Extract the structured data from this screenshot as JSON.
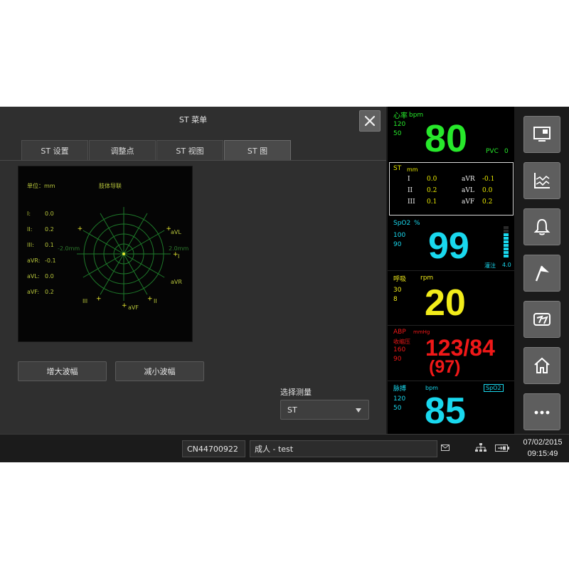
{
  "dialog": {
    "title": "ST 菜单",
    "tabs": [
      {
        "label": "ST 设置",
        "active": false
      },
      {
        "label": "调整点",
        "active": false
      },
      {
        "label": "ST 视图",
        "active": false
      },
      {
        "label": "ST 图",
        "active": true
      }
    ],
    "graph": {
      "unit": "单位：mm",
      "lead_group": "肢体导联",
      "scale_left": "-2.0mm",
      "scale_right": "2.0mm",
      "leads": [
        {
          "name": "I:",
          "value": "0.0"
        },
        {
          "name": "II:",
          "value": "0.2"
        },
        {
          "name": "III:",
          "value": "0.1"
        },
        {
          "name": "aVR:",
          "value": "-0.1"
        },
        {
          "name": "aVL:",
          "value": "0.0"
        },
        {
          "name": "aVF:",
          "value": "0.2"
        }
      ],
      "axis_labels": {
        "I": "I",
        "II": "II",
        "III": "III",
        "aVR": "aVR",
        "aVL": "aVL",
        "aVF": "aVF"
      }
    },
    "increase_btn": "增大波幅",
    "decrease_btn": "减小波幅",
    "measure_label": "选择测量",
    "measure_value": "ST"
  },
  "params": {
    "hr": {
      "label": "心率",
      "unit": "bpm",
      "high": "120",
      "low": "50",
      "value": "80",
      "pvc_label": "PVC",
      "pvc_value": "0",
      "color": "#27e82b"
    },
    "st": {
      "label": "ST",
      "unit": "mm",
      "rows": [
        {
          "l1": "I",
          "v1": "0.0",
          "l2": "aVR",
          "v2": "-0.1"
        },
        {
          "l1": "II",
          "v1": "0.2",
          "l2": "aVL",
          "v2": "0.0"
        },
        {
          "l1": "III",
          "v1": "0.1",
          "l2": "aVF",
          "v2": "0.2"
        }
      ]
    },
    "spo2": {
      "label": "SpO2",
      "unit": "%",
      "high": "100",
      "low": "90",
      "value": "99",
      "perf_label": "灌注",
      "perf_value": "4.0",
      "color": "#19d8ee",
      "bar_level": 0.8
    },
    "resp": {
      "label": "呼吸",
      "unit": "rpm",
      "high": "30",
      "low": "8",
      "value": "20",
      "color": "#f2ec1a"
    },
    "abp": {
      "label": "ABP",
      "unit": "mmHg",
      "sub_label": "收缩压",
      "high": "160",
      "low": "90",
      "value": "123/84",
      "mean": "(97)",
      "color": "#f01818"
    },
    "pr": {
      "label": "脉搏",
      "unit": "bpm",
      "source": "SpO2",
      "high": "120",
      "low": "50",
      "value": "85",
      "color": "#19d8ee"
    }
  },
  "sidebar": {
    "buttons": [
      {
        "icon": "screen-layout-icon"
      },
      {
        "icon": "trend-chart-icon"
      },
      {
        "icon": "alarm-bell-icon"
      },
      {
        "icon": "event-flag-icon"
      },
      {
        "icon": "freeze-icon"
      },
      {
        "icon": "home-icon"
      },
      {
        "icon": "more-icon"
      }
    ]
  },
  "status": {
    "device_id": "CN44700922",
    "patient": "成人 - test",
    "date": "07/02/2015",
    "time": "09:15:49"
  }
}
